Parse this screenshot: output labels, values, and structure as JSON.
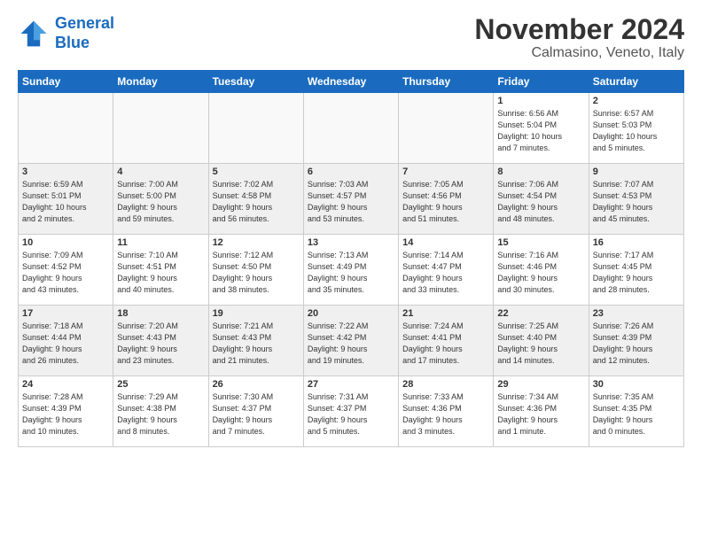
{
  "header": {
    "logo_line1": "General",
    "logo_line2": "Blue",
    "title": "November 2024",
    "subtitle": "Calmasino, Veneto, Italy"
  },
  "weekdays": [
    "Sunday",
    "Monday",
    "Tuesday",
    "Wednesday",
    "Thursday",
    "Friday",
    "Saturday"
  ],
  "weeks": [
    [
      {
        "day": "",
        "info": ""
      },
      {
        "day": "",
        "info": ""
      },
      {
        "day": "",
        "info": ""
      },
      {
        "day": "",
        "info": ""
      },
      {
        "day": "",
        "info": ""
      },
      {
        "day": "1",
        "info": "Sunrise: 6:56 AM\nSunset: 5:04 PM\nDaylight: 10 hours\nand 7 minutes."
      },
      {
        "day": "2",
        "info": "Sunrise: 6:57 AM\nSunset: 5:03 PM\nDaylight: 10 hours\nand 5 minutes."
      }
    ],
    [
      {
        "day": "3",
        "info": "Sunrise: 6:59 AM\nSunset: 5:01 PM\nDaylight: 10 hours\nand 2 minutes."
      },
      {
        "day": "4",
        "info": "Sunrise: 7:00 AM\nSunset: 5:00 PM\nDaylight: 9 hours\nand 59 minutes."
      },
      {
        "day": "5",
        "info": "Sunrise: 7:02 AM\nSunset: 4:58 PM\nDaylight: 9 hours\nand 56 minutes."
      },
      {
        "day": "6",
        "info": "Sunrise: 7:03 AM\nSunset: 4:57 PM\nDaylight: 9 hours\nand 53 minutes."
      },
      {
        "day": "7",
        "info": "Sunrise: 7:05 AM\nSunset: 4:56 PM\nDaylight: 9 hours\nand 51 minutes."
      },
      {
        "day": "8",
        "info": "Sunrise: 7:06 AM\nSunset: 4:54 PM\nDaylight: 9 hours\nand 48 minutes."
      },
      {
        "day": "9",
        "info": "Sunrise: 7:07 AM\nSunset: 4:53 PM\nDaylight: 9 hours\nand 45 minutes."
      }
    ],
    [
      {
        "day": "10",
        "info": "Sunrise: 7:09 AM\nSunset: 4:52 PM\nDaylight: 9 hours\nand 43 minutes."
      },
      {
        "day": "11",
        "info": "Sunrise: 7:10 AM\nSunset: 4:51 PM\nDaylight: 9 hours\nand 40 minutes."
      },
      {
        "day": "12",
        "info": "Sunrise: 7:12 AM\nSunset: 4:50 PM\nDaylight: 9 hours\nand 38 minutes."
      },
      {
        "day": "13",
        "info": "Sunrise: 7:13 AM\nSunset: 4:49 PM\nDaylight: 9 hours\nand 35 minutes."
      },
      {
        "day": "14",
        "info": "Sunrise: 7:14 AM\nSunset: 4:47 PM\nDaylight: 9 hours\nand 33 minutes."
      },
      {
        "day": "15",
        "info": "Sunrise: 7:16 AM\nSunset: 4:46 PM\nDaylight: 9 hours\nand 30 minutes."
      },
      {
        "day": "16",
        "info": "Sunrise: 7:17 AM\nSunset: 4:45 PM\nDaylight: 9 hours\nand 28 minutes."
      }
    ],
    [
      {
        "day": "17",
        "info": "Sunrise: 7:18 AM\nSunset: 4:44 PM\nDaylight: 9 hours\nand 26 minutes."
      },
      {
        "day": "18",
        "info": "Sunrise: 7:20 AM\nSunset: 4:43 PM\nDaylight: 9 hours\nand 23 minutes."
      },
      {
        "day": "19",
        "info": "Sunrise: 7:21 AM\nSunset: 4:43 PM\nDaylight: 9 hours\nand 21 minutes."
      },
      {
        "day": "20",
        "info": "Sunrise: 7:22 AM\nSunset: 4:42 PM\nDaylight: 9 hours\nand 19 minutes."
      },
      {
        "day": "21",
        "info": "Sunrise: 7:24 AM\nSunset: 4:41 PM\nDaylight: 9 hours\nand 17 minutes."
      },
      {
        "day": "22",
        "info": "Sunrise: 7:25 AM\nSunset: 4:40 PM\nDaylight: 9 hours\nand 14 minutes."
      },
      {
        "day": "23",
        "info": "Sunrise: 7:26 AM\nSunset: 4:39 PM\nDaylight: 9 hours\nand 12 minutes."
      }
    ],
    [
      {
        "day": "24",
        "info": "Sunrise: 7:28 AM\nSunset: 4:39 PM\nDaylight: 9 hours\nand 10 minutes."
      },
      {
        "day": "25",
        "info": "Sunrise: 7:29 AM\nSunset: 4:38 PM\nDaylight: 9 hours\nand 8 minutes."
      },
      {
        "day": "26",
        "info": "Sunrise: 7:30 AM\nSunset: 4:37 PM\nDaylight: 9 hours\nand 7 minutes."
      },
      {
        "day": "27",
        "info": "Sunrise: 7:31 AM\nSunset: 4:37 PM\nDaylight: 9 hours\nand 5 minutes."
      },
      {
        "day": "28",
        "info": "Sunrise: 7:33 AM\nSunset: 4:36 PM\nDaylight: 9 hours\nand 3 minutes."
      },
      {
        "day": "29",
        "info": "Sunrise: 7:34 AM\nSunset: 4:36 PM\nDaylight: 9 hours\nand 1 minute."
      },
      {
        "day": "30",
        "info": "Sunrise: 7:35 AM\nSunset: 4:35 PM\nDaylight: 9 hours\nand 0 minutes."
      }
    ]
  ]
}
